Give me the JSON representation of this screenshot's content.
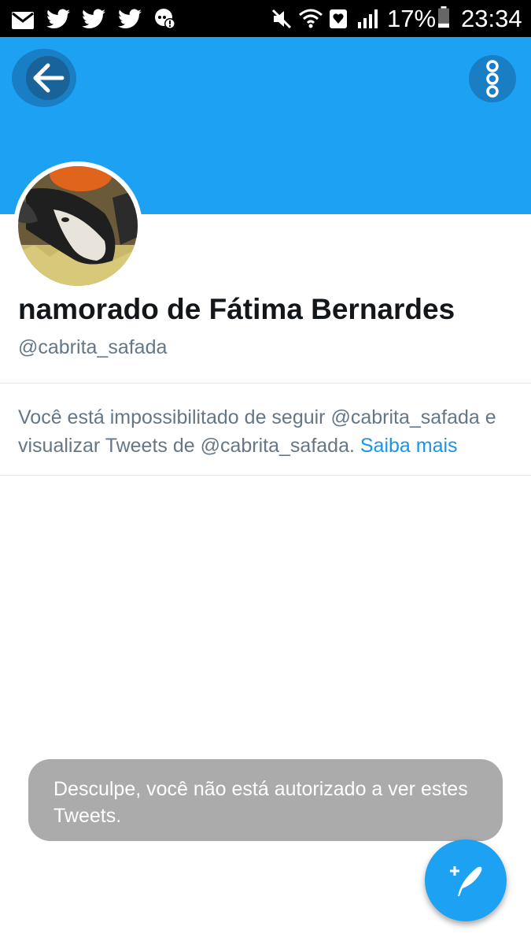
{
  "status_bar": {
    "battery_percent": "17%",
    "time": "23:34",
    "icons": [
      "mail-icon",
      "twitter-icon",
      "twitter-icon",
      "twitter-icon",
      "chat-alert-icon",
      "mute-icon",
      "wifi-icon",
      "heart-icon",
      "signal-icon",
      "battery-icon"
    ]
  },
  "header": {
    "back_icon": "arrow-left-icon",
    "menu_icon": "vertical-dots-icon",
    "banner_color": "#1da1f2"
  },
  "profile": {
    "display_name": "namorado de Fátima Bernardes",
    "handle": "@cabrita_safada"
  },
  "notice": {
    "text": "Você está impossibilitado de seguir @cabrita_safada e visualizar Tweets de @cabrita_safada.",
    "link": "Saiba mais"
  },
  "toast": {
    "message": "Desculpe, você não está autorizado a ver estes Tweets."
  },
  "fab": {
    "icon": "compose-tweet-icon"
  }
}
